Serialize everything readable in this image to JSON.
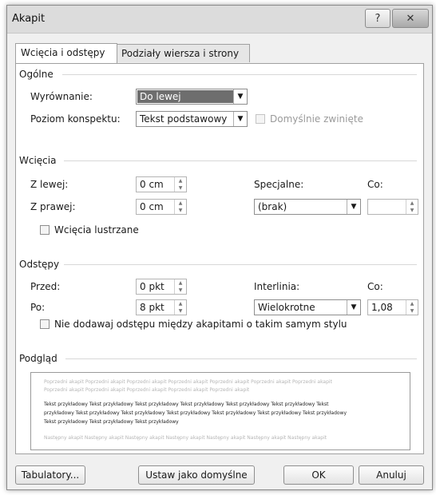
{
  "window": {
    "title": "Akapit",
    "help_glyph": "?",
    "close_glyph": "✕"
  },
  "tabs": [
    {
      "label": "Wcięcia i odstępy",
      "active": true
    },
    {
      "label": "Podziały wiersza i strony",
      "active": false
    }
  ],
  "general": {
    "title": "Ogólne",
    "alignment_label": "Wyrównanie:",
    "alignment_value": "Do lewej",
    "outline_label": "Poziom konspektu:",
    "outline_value": "Tekst podstawowy",
    "collapsed_label": "Domyślnie zwinięte"
  },
  "indents": {
    "title": "Wcięcia",
    "left_label": "Z lewej:",
    "left_value": "0 cm",
    "right_label": "Z prawej:",
    "right_value": "0 cm",
    "special_label": "Specjalne:",
    "special_value": "(brak)",
    "by_label": "Co:",
    "by_value": "",
    "mirror_label": "Wcięcia lustrzane"
  },
  "spacing": {
    "title": "Odstępy",
    "before_label": "Przed:",
    "before_value": "0 pkt",
    "after_label": "Po:",
    "after_value": "8 pkt",
    "line_label": "Interlinia:",
    "line_value": "Wielokrotne",
    "at_label": "Co:",
    "at_value": "1,08",
    "no_space_label": "Nie dodawaj odstępu między akapitami o takim samym stylu"
  },
  "preview": {
    "title": "Podgląd",
    "prev_lines": [
      "Poprzedni akapit Poprzedni akapit Poprzedni akapit Poprzedni akapit Poprzedni akapit Poprzedni akapit Poprzedni akapit",
      "Poprzedni akapit Poprzedni akapit Poprzedni akapit Poprzedni akapit Poprzedni akapit"
    ],
    "sample_lines": [
      "Tekst przykładowy Tekst przykładowy Tekst przykładowy Tekst przykładowy Tekst przykładowy Tekst przykładowy Tekst",
      "przykładowy Tekst przykładowy Tekst przykładowy Tekst przykładowy Tekst przykładowy Tekst przykładowy Tekst przykładowy",
      "Tekst przykładowy Tekst przykładowy Tekst przykładowy"
    ],
    "next_lines": [
      "Następny akapit Następny akapit Następny akapit Następny akapit Następny akapit Następny akapit Następny akapit"
    ]
  },
  "buttons": {
    "tabs": "Tabulatory...",
    "default": "Ustaw jako domyślne",
    "ok": "OK",
    "cancel": "Anuluj"
  }
}
